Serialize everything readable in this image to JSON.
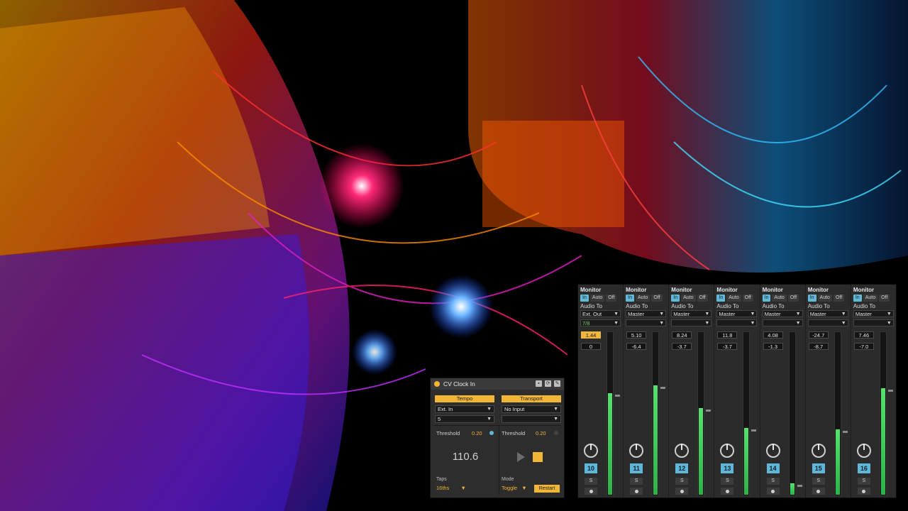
{
  "mixer": {
    "strips": [
      {
        "monitor_title": "Monitor",
        "mon_in": "In",
        "mon_auto": "Auto",
        "mon_off": "Off",
        "monitor_state": "in",
        "audio_to_label": "Audio To",
        "route": "Ext. Out",
        "sub_route": "7/8",
        "volume": "1.44",
        "volume_hot": true,
        "pan": "0",
        "track_number": "10",
        "solo": "S",
        "meter_level": 0.62
      },
      {
        "monitor_title": "Monitor",
        "mon_in": "In",
        "mon_auto": "Auto",
        "mon_off": "Off",
        "monitor_state": "in",
        "audio_to_label": "Audio To",
        "route": "Master",
        "sub_route": "",
        "volume": "5.10",
        "volume_hot": false,
        "pan": "-6.4",
        "track_number": "11",
        "solo": "S",
        "meter_level": 0.67
      },
      {
        "monitor_title": "Monitor",
        "mon_in": "In",
        "mon_auto": "Auto",
        "mon_off": "Off",
        "monitor_state": "in",
        "audio_to_label": "Audio To",
        "route": "Master",
        "sub_route": "",
        "volume": "8.24",
        "volume_hot": false,
        "pan": "-3.7",
        "track_number": "12",
        "solo": "S",
        "meter_level": 0.53
      },
      {
        "monitor_title": "Monitor",
        "mon_in": "In",
        "mon_auto": "Auto",
        "mon_off": "Off",
        "monitor_state": "in",
        "audio_to_label": "Audio To",
        "route": "Master",
        "sub_route": "",
        "volume": "11.8",
        "volume_hot": false,
        "pan": "-3.7",
        "track_number": "13",
        "solo": "S",
        "meter_level": 0.41
      },
      {
        "monitor_title": "Monitor",
        "mon_in": "In",
        "mon_auto": "Auto",
        "mon_off": "Off",
        "monitor_state": "in",
        "audio_to_label": "Audio To",
        "route": "Master",
        "sub_route": "",
        "volume": "4.08",
        "volume_hot": false,
        "pan": "-1.3",
        "track_number": "14",
        "solo": "S",
        "meter_level": 0.07
      },
      {
        "monitor_title": "Monitor",
        "mon_in": "In",
        "mon_auto": "Auto",
        "mon_off": "Off",
        "monitor_state": "in",
        "audio_to_label": "Audio To",
        "route": "Master",
        "sub_route": "",
        "volume": "-24.7",
        "volume_hot": false,
        "pan": "-8.7",
        "track_number": "15",
        "solo": "S",
        "meter_level": 0.4
      },
      {
        "monitor_title": "Monitor",
        "mon_in": "In",
        "mon_auto": "Auto",
        "mon_off": "Off",
        "monitor_state": "in",
        "audio_to_label": "Audio To",
        "route": "Master",
        "sub_route": "",
        "volume": "7.46",
        "volume_hot": false,
        "pan": "-7.0",
        "track_number": "16",
        "solo": "S",
        "meter_level": 0.65
      }
    ]
  },
  "cv_clock": {
    "title": "CV Clock In",
    "tempo_header": "Tempo",
    "transport_header": "Transport",
    "tempo_input": "Ext. In",
    "tempo_channel": "5",
    "transport_input": "No Input",
    "transport_channel": "",
    "threshold_label": "Threshold",
    "tempo_threshold": "0.20",
    "transport_threshold": "0.20",
    "bpm": "110.6",
    "taps_label": "Taps",
    "taps_value": "16ths",
    "mode_label": "Mode",
    "mode_value": "Toggle",
    "restart_label": "Restart"
  },
  "colors": {
    "accent": "#f2b637",
    "track_number": "#5fb7d8",
    "meter": "#3fd45a"
  }
}
